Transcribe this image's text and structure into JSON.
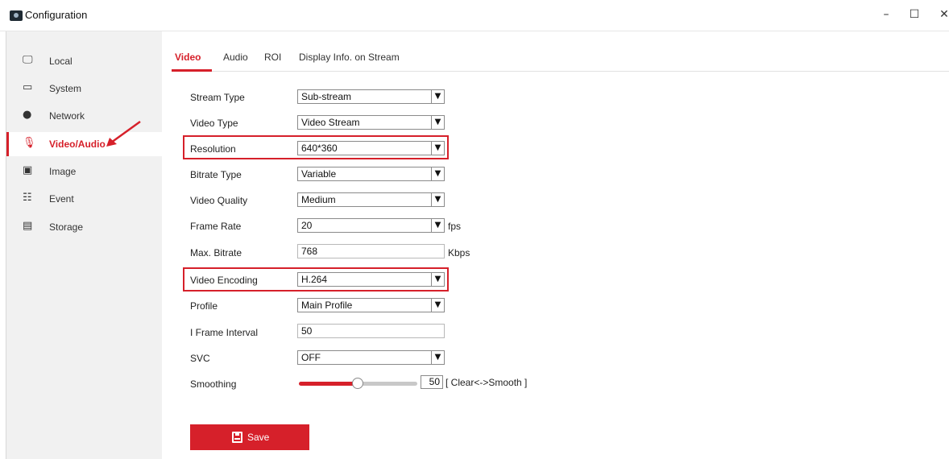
{
  "window": {
    "title": "Configuration",
    "minimize_glyph": "–",
    "maximize_glyph": "☐",
    "close_glyph": "✕"
  },
  "sidebar": {
    "items": [
      {
        "label": "Local",
        "icon": "monitor-icon",
        "glyph": "🖵"
      },
      {
        "label": "System",
        "icon": "system-icon",
        "glyph": "▭"
      },
      {
        "label": "Network",
        "icon": "globe-icon",
        "glyph": "●"
      },
      {
        "label": "Video/Audio",
        "icon": "microphone-icon",
        "glyph": "🎙",
        "active": true
      },
      {
        "label": "Image",
        "icon": "image-icon",
        "glyph": "▣"
      },
      {
        "label": "Event",
        "icon": "calendar-icon",
        "glyph": "☷"
      },
      {
        "label": "Storage",
        "icon": "floppy-icon",
        "glyph": "▤"
      }
    ]
  },
  "tabs": [
    {
      "label": "Video",
      "active": true
    },
    {
      "label": "Audio"
    },
    {
      "label": "ROI"
    },
    {
      "label": "Display Info. on Stream"
    }
  ],
  "form": {
    "stream_type": {
      "label": "Stream Type",
      "value": "Sub-stream"
    },
    "video_type": {
      "label": "Video Type",
      "value": "Video Stream"
    },
    "resolution": {
      "label": "Resolution",
      "value": "640*360"
    },
    "bitrate_type": {
      "label": "Bitrate Type",
      "value": "Variable"
    },
    "video_quality": {
      "label": "Video Quality",
      "value": "Medium"
    },
    "frame_rate": {
      "label": "Frame Rate",
      "value": "20",
      "unit": "fps"
    },
    "max_bitrate": {
      "label": "Max. Bitrate",
      "value": "768",
      "unit": "Kbps"
    },
    "video_encoding": {
      "label": "Video Encoding",
      "value": "H.264"
    },
    "profile": {
      "label": "Profile",
      "value": "Main Profile"
    },
    "i_frame_interval": {
      "label": "I Frame Interval",
      "value": "50"
    },
    "svc": {
      "label": "SVC",
      "value": "OFF"
    },
    "smoothing": {
      "label": "Smoothing",
      "value": "50",
      "hint": "[ Clear<->Smooth ]",
      "level_percent": 50
    }
  },
  "save_button": {
    "label": "Save"
  },
  "colors": {
    "accent": "#d6202a",
    "sidebar_bg": "#f1f1f1"
  }
}
